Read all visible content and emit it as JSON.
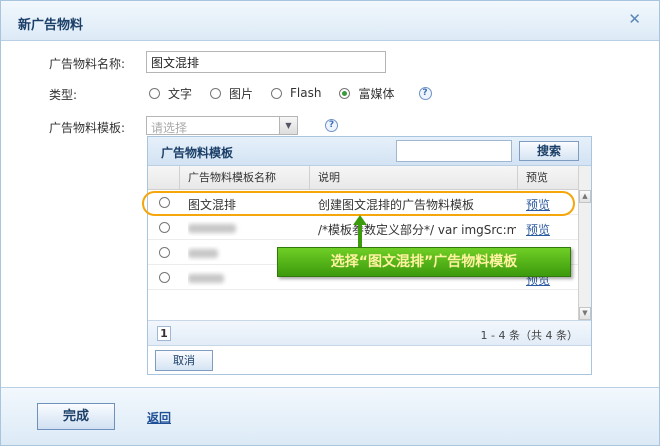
{
  "dialog": {
    "title": "新广告物料",
    "close_glyph": "✕"
  },
  "form": {
    "name_label": "广告物料名称:",
    "name_value": "图文混排",
    "type_label": "类型:",
    "type_options": [
      {
        "label": "文字",
        "checked": false
      },
      {
        "label": "图片",
        "checked": false
      },
      {
        "label": "Flash",
        "checked": false
      },
      {
        "label": "富媒体",
        "checked": true
      }
    ],
    "template_label": "广告物料模板:",
    "template_placeholder": "请选择",
    "help_glyph": "?"
  },
  "panel": {
    "title": "广告物料模板",
    "search_button": "搜索",
    "columns": [
      "广告物料模板名称",
      "说明",
      "预览"
    ],
    "rows": [
      {
        "name": "图文混排",
        "desc": "创建图文混排的广告物料模板",
        "preview": "预览",
        "redacted": false
      },
      {
        "name": "",
        "desc": "/*模板参数定义部分*/ var imgSrc:mec",
        "preview": "预览",
        "redacted": true
      },
      {
        "name": "",
        "desc": "",
        "preview": "",
        "redacted": true
      },
      {
        "name": "",
        "desc": "",
        "preview": "预览",
        "redacted": true
      }
    ],
    "page_number": "1",
    "page_info": "1 - 4 条（共 4 条）",
    "cancel_button": "取消"
  },
  "annotation": {
    "callout_text": "选择“图文混排”广告物料模板",
    "accent_color": "#f4a60a",
    "callout_color": "#4caf1a"
  },
  "footer": {
    "done_button": "完成",
    "back_link": "返回"
  }
}
